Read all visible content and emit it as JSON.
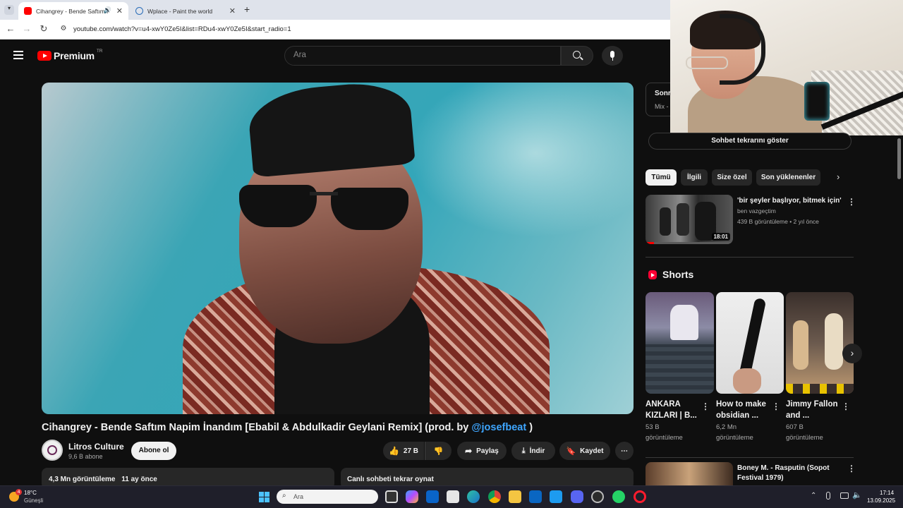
{
  "browser": {
    "tabs": [
      {
        "title": "Cihangrey - Bende Saftım N",
        "active": true
      },
      {
        "title": "Wplace - Paint the world",
        "active": false
      }
    ],
    "url": "youtube.com/watch?v=u4-xwY0Ze5I&list=RDu4-xwY0Ze5I&start_radio=1"
  },
  "header": {
    "logo": "Premium",
    "region": "TR",
    "search_placeholder": "Ara"
  },
  "video": {
    "title_main": "Cihangrey - Bende Saftım Napim İnandım [Ebabil & Abdulkadir Geylani Remix] (prod. by ",
    "title_link": "@josefbeat",
    "title_end": " )",
    "channel": "Litros Culture",
    "subscribers": "9,6 B abone",
    "subscribe_label": "Abone ol",
    "likes": "27 B",
    "share_label": "Paylaş",
    "download_label": "İndir",
    "save_label": "Kaydet",
    "views": "4,3 Mn görüntüleme",
    "age": "11 ay önce",
    "chat_replay": "Canlı sohbeti tekrar oynat"
  },
  "sidebar": {
    "mix_title": "Sonr",
    "mix_sub": "Mix -",
    "show_chat": "Sohbet tekrarını göster",
    "chips": [
      "Tümü",
      "İlgili",
      "Size özel",
      "Son yüklenenler"
    ],
    "recommended": [
      {
        "title": "'bir şeyler başlıyor, bitmek için'",
        "channel": "ben vazgeçtim",
        "meta": "439 B görüntüleme • 2 yıl önce",
        "duration": "18:01"
      },
      {
        "title": "Boney M. - Rasputin (Sopot Festival 1979)"
      }
    ],
    "shorts_heading": "Shorts",
    "shorts": [
      {
        "title": "ANKARA KIZLARI | B...",
        "views": "53 B",
        "label": "görüntüleme"
      },
      {
        "title": "How to make obsidian ...",
        "views": "6,2 Mn",
        "label": "görüntüleme"
      },
      {
        "title": "Jimmy Fallon and ...",
        "views": "607 B",
        "label": "görüntüleme"
      }
    ]
  },
  "taskbar": {
    "temp": "18°C",
    "weather": "Güneşli",
    "search_placeholder": "Ara",
    "time": "17:14",
    "date": "13.09.2025",
    "badge": "4"
  }
}
